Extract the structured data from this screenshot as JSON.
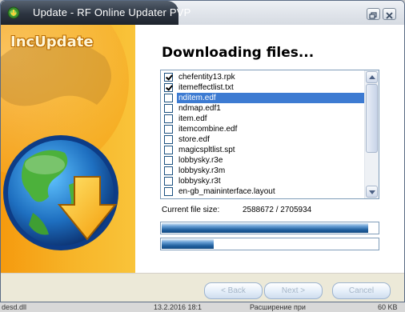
{
  "window": {
    "title": "Update - RF Online Updater PVP"
  },
  "sidebar": {
    "brand": "IncUpdate"
  },
  "main": {
    "heading": "Downloading files...",
    "files": [
      {
        "name": "chefentity13.rpk",
        "checked": true,
        "selected": false
      },
      {
        "name": "itemeffectlist.txt",
        "checked": true,
        "selected": false
      },
      {
        "name": "nditem.edf",
        "checked": false,
        "selected": true
      },
      {
        "name": "ndmap.edf1",
        "checked": false,
        "selected": false
      },
      {
        "name": "item.edf",
        "checked": false,
        "selected": false
      },
      {
        "name": "itemcombine.edf",
        "checked": false,
        "selected": false
      },
      {
        "name": "store.edf",
        "checked": false,
        "selected": false
      },
      {
        "name": "magicspltlist.spt",
        "checked": false,
        "selected": false
      },
      {
        "name": "lobbysky.r3e",
        "checked": false,
        "selected": false
      },
      {
        "name": "lobbysky.r3m",
        "checked": false,
        "selected": false
      },
      {
        "name": "lobbysky.r3t",
        "checked": false,
        "selected": false
      },
      {
        "name": "en-gb_maininterface.layout",
        "checked": false,
        "selected": false
      }
    ],
    "current_file_size_label": "Current file size:",
    "current_file_size_value": "2588672 / 2705934",
    "file_progress_fraction": 0.957,
    "total_progress_fraction": 0.24
  },
  "footer": {
    "back_label": "< Back",
    "next_label": "Next >",
    "cancel_label": "Cancel"
  },
  "background": {
    "left_text": "desd.dll",
    "mid_text": "13.2.2016 18:1",
    "right_text": "Расширение при",
    "size_text": "60 KB"
  },
  "colors": {
    "sidebar_orange": "#f7b529",
    "selection_blue": "#3d7bd2",
    "progress_blue": "#1f5f9e",
    "titlebar_dark": "#2c3440"
  }
}
